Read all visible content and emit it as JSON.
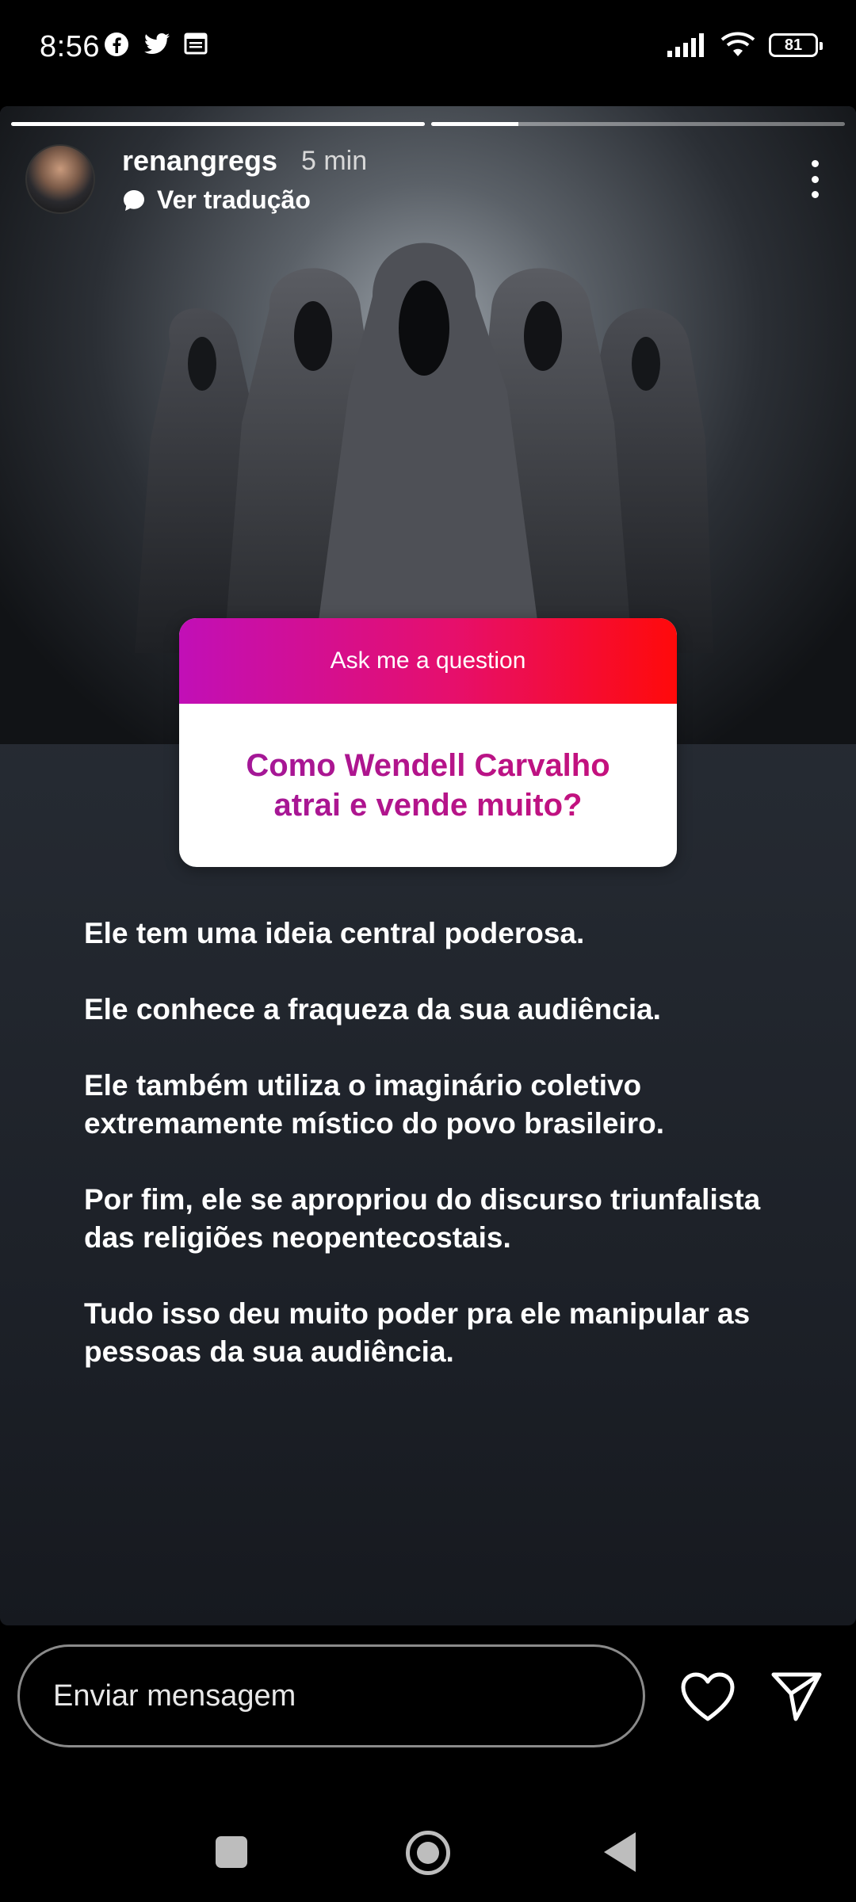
{
  "status_bar": {
    "time": "8:56",
    "left_icons": [
      "facebook-icon",
      "twitter-icon",
      "calendar-icon"
    ],
    "right_icons": [
      "signal-icon",
      "wifi-icon",
      "battery-icon"
    ],
    "battery_level": "81"
  },
  "story": {
    "progress": [
      1.0,
      0.21
    ],
    "header": {
      "username": "renangregs",
      "time_ago": "5 min",
      "translate_label": "Ver tradução"
    },
    "question_card": {
      "header": "Ask me a question",
      "question": "Como Wendell Carvalho atrai e vende muito?"
    },
    "paragraphs": [
      "Ele tem uma ideia central poderosa.",
      "Ele conhece a fraqueza da sua audiência.",
      "Ele também utiliza o imaginário coletivo extremamente místico do povo brasileiro.",
      "Por fim, ele se apropriou do discurso triunfalista das religiões neopentecostais.",
      "Tudo isso deu muito poder pra ele manipular as pessoas da sua audiência."
    ],
    "image_subject": "hooded-figures"
  },
  "composer": {
    "placeholder": "Enviar mensagem",
    "icons": [
      "heart-icon",
      "send-icon"
    ]
  },
  "nav_bar": {
    "icons": [
      "recent-apps-icon",
      "home-icon",
      "back-icon"
    ]
  },
  "colors": {
    "card_gradient_start": "#c10fb7",
    "card_gradient_end": "#ff0a0a",
    "question_text": "#b0148a"
  }
}
